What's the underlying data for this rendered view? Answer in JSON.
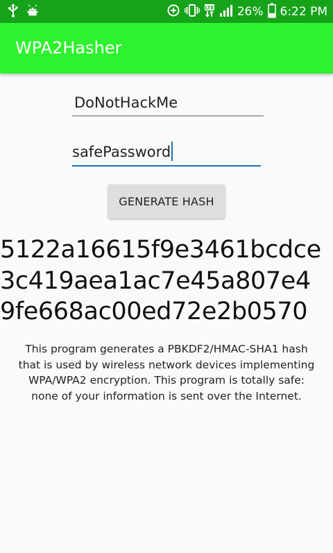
{
  "status_bar": {
    "icons_left": [
      "usb-icon",
      "android-debug-icon"
    ],
    "icons_right": [
      "data-saver-icon",
      "vibrate-icon",
      "lte-icon",
      "signal-icon"
    ],
    "battery": "26%",
    "time": "6:22 PM",
    "colors": {
      "background": "#16a31a"
    }
  },
  "app_bar": {
    "title": "WPA2Hasher",
    "colors": {
      "background": "#2ef22e"
    }
  },
  "form": {
    "ssid_value": "DoNotHackMe",
    "password_value": "safePassword",
    "generate_label": "GENERATE HASH"
  },
  "result": {
    "hash_lines": [
      "5122a16615f9e3461bcdce",
      "3c419aea1ac7e45a807e4",
      "9fe668ac00ed72e2b0570"
    ]
  },
  "description": {
    "lines": [
      "This program generates a PBKDF2/HMAC-SHA1 hash",
      "that is used by wireless network devices implementing",
      "WPA/WPA2 encryption. This program is totally safe:",
      "none of your information is sent over the Internet."
    ]
  }
}
